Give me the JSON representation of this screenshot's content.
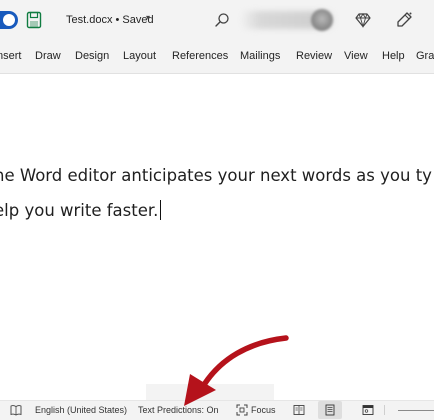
{
  "titlebar": {
    "document_title": "Test.docx • Saved",
    "title_chevron": "▾"
  },
  "ribbon": {
    "tabs": [
      "nsert",
      "Draw",
      "Design",
      "Layout",
      "References",
      "Mailings",
      "Review",
      "View",
      "Help",
      "Gra"
    ]
  },
  "document": {
    "lines": [
      "he Word editor anticipates your next words as you ty",
      "elp you write faster."
    ]
  },
  "statusbar": {
    "language": "English (United States)",
    "text_predictions": "Text Predictions: On",
    "focus": "Focus"
  },
  "colors": {
    "accent": "#185abd",
    "annotation_arrow": "#b5121b",
    "ribbon_bg": "#f3f3f3"
  },
  "icons": [
    "save-icon",
    "search-icon",
    "diamond-icon",
    "pen-icon",
    "book-icon",
    "focus-icon",
    "read-mode-icon",
    "print-layout-icon",
    "web-layout-icon"
  ]
}
